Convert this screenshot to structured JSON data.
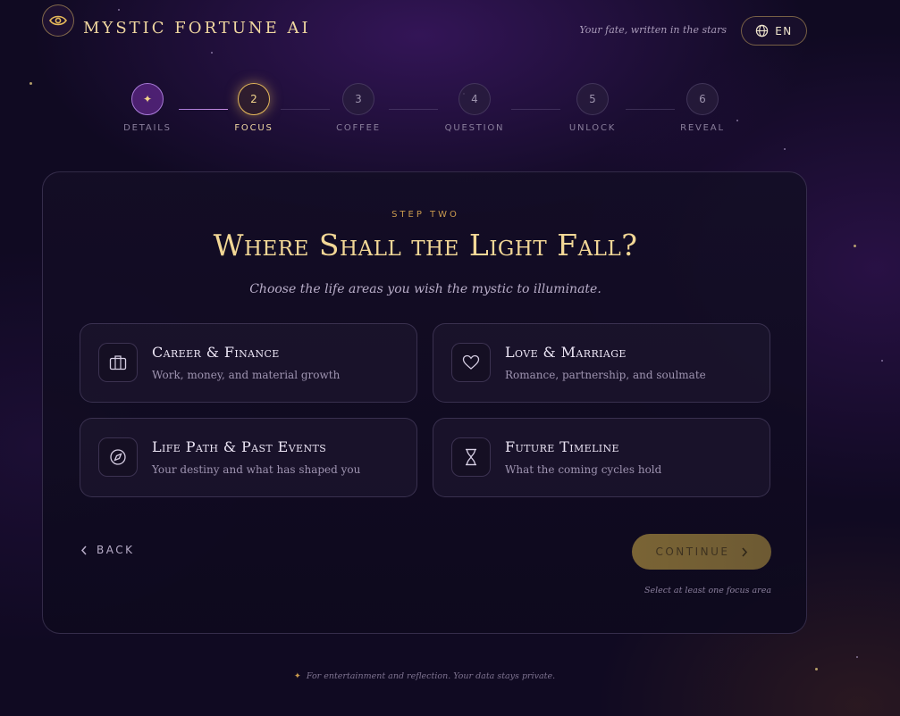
{
  "header": {
    "brand": "MYSTIC FORTUNE AI",
    "tagline": "Your fate, written in the stars",
    "language": "EN"
  },
  "stepper": [
    {
      "number": "✦",
      "label": "DETAILS",
      "state": "done"
    },
    {
      "number": "2",
      "label": "FOCUS",
      "state": "active"
    },
    {
      "number": "3",
      "label": "COFFEE",
      "state": "pending"
    },
    {
      "number": "4",
      "label": "QUESTION",
      "state": "pending"
    },
    {
      "number": "5",
      "label": "UNLOCK",
      "state": "pending"
    },
    {
      "number": "6",
      "label": "REVEAL",
      "state": "pending"
    }
  ],
  "card": {
    "kicker": "STEP TWO",
    "title": "Where Shall the Light Fall?",
    "subtitle": "Choose the life areas you wish the mystic to illuminate.",
    "options": [
      {
        "title": "Career & Finance",
        "desc": "Work, money, and material growth",
        "icon": "briefcase-icon"
      },
      {
        "title": "Love & Marriage",
        "desc": "Romance, partnership, and soulmate",
        "icon": "heart-icon"
      },
      {
        "title": "Life Path & Past Events",
        "desc": "Your destiny and what has shaped you",
        "icon": "compass-icon"
      },
      {
        "title": "Future Timeline",
        "desc": "What the coming cycles hold",
        "icon": "hourglass-icon"
      }
    ],
    "back_label": "BACK",
    "continue_label": "CONTINUE",
    "hint": "Select at least one focus area"
  },
  "footer": {
    "text": "For entertainment and reflection. Your data stays private."
  },
  "colors": {
    "accent_gold": "#f2d796",
    "background": "#100a22",
    "done_purple": "#a77ad6"
  }
}
